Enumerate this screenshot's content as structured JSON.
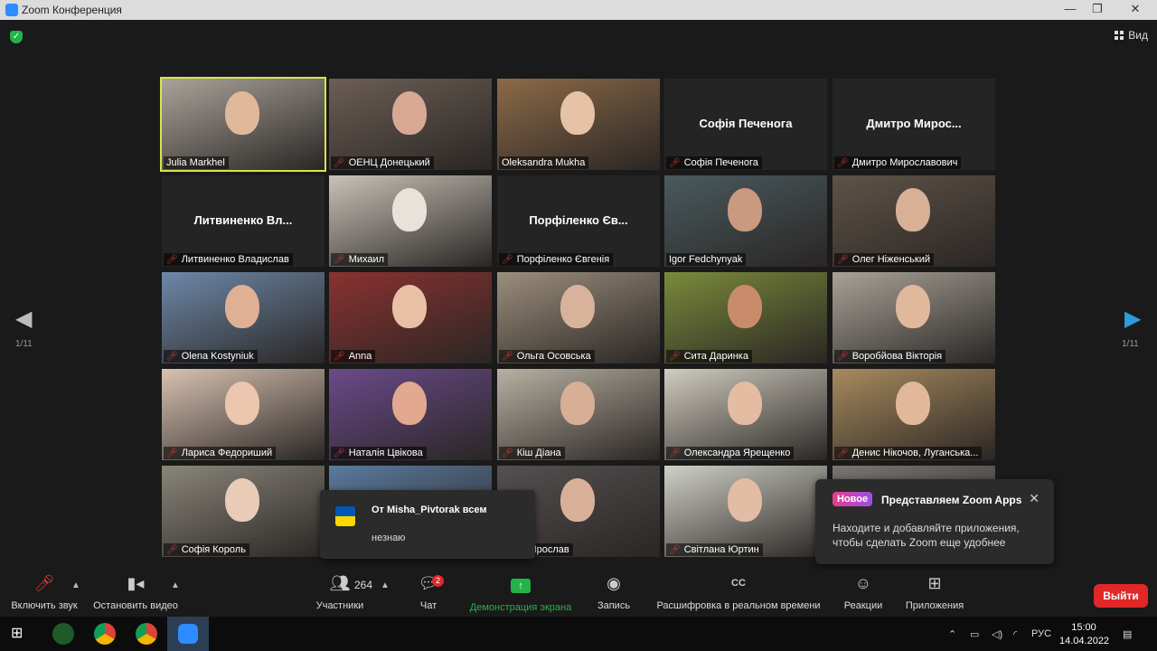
{
  "window": {
    "title": "Zoom Конференция",
    "controls": [
      "—",
      "❐",
      "✕"
    ]
  },
  "top_bar": {
    "view_label": "Вид"
  },
  "gallery": {
    "page_indicator_left": "1/11",
    "page_indicator_right": "1/11",
    "tiles": [
      {
        "label": "Julia Markhel",
        "muted": false,
        "active": true,
        "video": "#a9a39a",
        "face": "#e0b99a"
      },
      {
        "label": "ОЕНЦ Донецький",
        "muted": true,
        "video": "#6b5e55",
        "face": "#d9a894"
      },
      {
        "label": "Oleksandra Mukha",
        "muted": false,
        "video": "#8c6a48",
        "face": "#e6c2a6"
      },
      {
        "label": "Софія Печенога",
        "muted": true,
        "name_only": true,
        "display_name": "Софія Печенога"
      },
      {
        "label": "Дмитро Мирославович",
        "muted": true,
        "name_only": true,
        "display_name": "Дмитро  Мирос..."
      },
      {
        "label": "Литвиненко Владислав",
        "muted": true,
        "name_only": true,
        "display_name": "Литвиненко  Вл..."
      },
      {
        "label": "Михаил",
        "muted": true,
        "video": "#c8c2b8",
        "face": "#e8e3da"
      },
      {
        "label": "Порфіленко Євгенія",
        "muted": true,
        "name_only": true,
        "display_name": "Порфіленко  Єв..."
      },
      {
        "label": "Igor Fedchynyak",
        "muted": false,
        "video": "#4a5a5e",
        "face": "#c99a80"
      },
      {
        "label": "Олег Ніженський",
        "muted": true,
        "video": "#5e5348",
        "face": "#d8b095"
      },
      {
        "label": "Olena Kostyniuk",
        "muted": true,
        "video": "#6d88a8",
        "face": "#e0b094"
      },
      {
        "label": "Anna",
        "muted": true,
        "video": "#8a3230",
        "face": "#e8c0a6"
      },
      {
        "label": "Ольга Осовська",
        "muted": true,
        "video": "#9b8e7c",
        "face": "#d8b29a"
      },
      {
        "label": "Сита Даринка",
        "muted": true,
        "video": "#7a8a3a",
        "face": "#c98c6a"
      },
      {
        "label": "Воробйова Вікторія",
        "muted": true,
        "video": "#a8a298",
        "face": "#e0b89c"
      },
      {
        "label": "Лариса Федориший",
        "muted": true,
        "video": "#d8c2b2",
        "face": "#ecc6ae"
      },
      {
        "label": "Наталія Цвікова",
        "muted": true,
        "video": "#6a4a8a",
        "face": "#e2a890"
      },
      {
        "label": "Кіш Діана",
        "muted": true,
        "video": "#b8b0a2",
        "face": "#d8ae96"
      },
      {
        "label": "Олександра Ярещенко",
        "muted": true,
        "video": "#d0ccc0",
        "face": "#e4bca2"
      },
      {
        "label": "Денис Нікочов, Луганська...",
        "muted": true,
        "video": "#a88a5e",
        "face": "#e2b89a"
      },
      {
        "label": "Софія Король",
        "muted": true,
        "video": "#8a857a",
        "face": "#e8ccb8"
      },
      {
        "label": "",
        "muted": false,
        "video": "#5a7a9e",
        "face": "#ccc"
      },
      {
        "label": "ак Ярослав",
        "muted": true,
        "video": "#555050",
        "face": "#d8b09a"
      },
      {
        "label": "Світлана Юртин",
        "muted": true,
        "video": "#cfd0c6",
        "face": "#e2bca4"
      },
      {
        "label": "",
        "muted": false,
        "video": "#7a7570",
        "face": "#ccc"
      }
    ]
  },
  "chat_popup": {
    "from": "От Misha_Pivtorak всем",
    "message": "незнаю"
  },
  "apps_popup": {
    "badge": "Новое",
    "title": "Представляем Zoom Apps",
    "close": "✕",
    "body": "Находите и добавляйте приложения, чтобы сделать Zoom еще удобнее"
  },
  "toolbar": {
    "unmute": "Включить звук",
    "stop_video": "Остановить видео",
    "participants": "Участники",
    "participants_count": "264",
    "chat": "Чат",
    "chat_badge": "2",
    "share": "Демонстрация экрана",
    "record": "Запись",
    "transcript": "Расшифровка в реальном времени",
    "reactions": "Реакции",
    "apps": "Приложения",
    "leave": "Выйти"
  },
  "taskbar": {
    "lang": "РУС",
    "time": "15:00",
    "date": "14.04.2022",
    "notif": "1"
  },
  "colors": {
    "active_speaker": "#d8e645",
    "share_green": "#23b34a",
    "leave_red": "#e02828",
    "mute_red": "#e0383a",
    "nav_blue": "#2d9cdb"
  }
}
